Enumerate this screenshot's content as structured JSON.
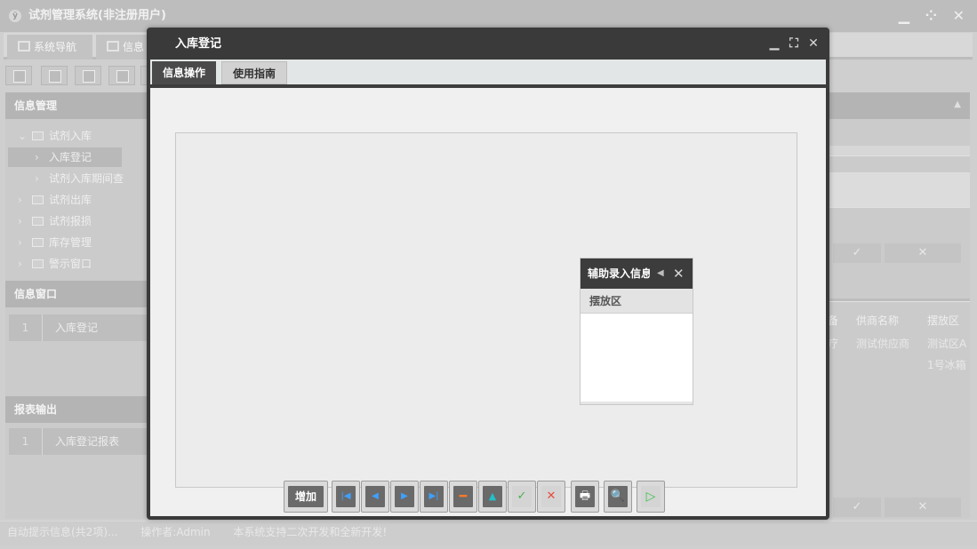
{
  "app": {
    "title": "试剂管理系统(非注册用户)",
    "logo_text": "ÿ",
    "window_buttons": "▁ ⁘ ✕",
    "tabs": [
      {
        "label": "系统导航"
      },
      {
        "label": "信息"
      }
    ]
  },
  "sidebar": {
    "info_management": {
      "header": "信息管理",
      "tree": [
        {
          "label": "试剂入库",
          "arrow": "⌄"
        },
        {
          "label": "入库登记",
          "arrow": "›"
        },
        {
          "label": "试剂入库期间查",
          "arrow": "›"
        },
        {
          "label": "试剂出库",
          "arrow": "›"
        },
        {
          "label": "试剂报损",
          "arrow": "›"
        },
        {
          "label": "库存管理",
          "arrow": "›"
        },
        {
          "label": "警示窗口",
          "arrow": "›"
        }
      ]
    },
    "info_window": {
      "header": "信息窗口",
      "rows": [
        {
          "num": "1",
          "label": "入库登记"
        }
      ]
    },
    "report_output": {
      "header": "报表输出",
      "rows": [
        {
          "num": "1",
          "label": "入库登记报表"
        }
      ]
    }
  },
  "right_pane": {
    "columns": [
      "备",
      "供商名称",
      "摆放区"
    ],
    "cells": [
      "疗",
      "测试供应商",
      "测试区A",
      "1号冰箱"
    ],
    "ok_symbol": "✓",
    "cancel_symbol": "✕"
  },
  "statusbar": {
    "hint": "自动提示信息(共2项)...",
    "operator": "操作者:Admin",
    "notice": "本系统支持二次开发和全新开发!"
  },
  "dialog": {
    "title": "入库登记",
    "buttons": {
      "minimize": "▁",
      "maximize": "⛶",
      "close": "✕"
    },
    "tabs": {
      "operation": "信息操作",
      "guide": "使用指南"
    },
    "aux_panel": {
      "title": "辅助录入信息",
      "column": "摆放区",
      "collapse": "◀",
      "close": "✕"
    },
    "nav": {
      "add": "增加"
    }
  },
  "colors": {
    "dialog_frame": "#3a3a3a",
    "nav_blue": "#3ea0ff",
    "delete_orange": "#ff7a2a",
    "up_teal": "#22c0c8",
    "ok_green": "#4caf50",
    "cancel_red": "#e74c3c"
  }
}
